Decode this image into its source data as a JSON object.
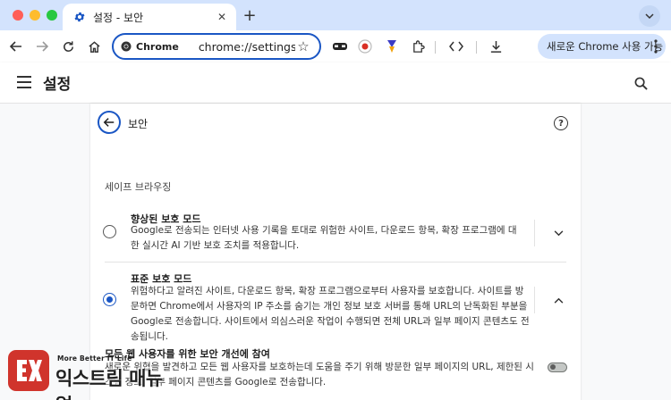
{
  "browser": {
    "tab": {
      "title": "설정 - 보안"
    },
    "omnibox": {
      "chip_label": "Chrome",
      "url": "chrome://settings/se..."
    },
    "update_label": "새로운 Chrome 사용 가능"
  },
  "settings": {
    "title": "설정",
    "page": {
      "heading": "보안",
      "help_label": "?"
    },
    "section_title": "세이프 브라우징",
    "options": [
      {
        "title": "향상된 보호 모드",
        "description": "Google로 전송되는 인터넷 사용 기록을 토대로 위험한 사이트, 다운로드 항목, 확장 프로그램에 대한 실시간 AI 기반 보호 조치를 적용합니다.",
        "selected": false
      },
      {
        "title": "표준 보호 모드",
        "description": "위험하다고 알려진 사이트, 다운로드 항목, 확장 프로그램으로부터 사용자를 보호합니다. 사이트를 방문하면 Chrome에서 사용자의 IP 주소를 숨기는 개인 정보 보호 서버를 통해 URL의 난독화된 부분을 Google로 전송합니다. 사이트에서 의심스러운 작업이 수행되면 전체 URL과 일부 페이지 콘텐츠도 전송됩니다.",
        "selected": true
      }
    ],
    "toggle_row": {
      "title": "모든 웹 사용자를 위한 보안 개선에 참여",
      "description": "새로운 위협을 발견하고 모든 웹 사용자를 보호하는데 도움을 주기 위해 방문한 일부 페이지의 URL, 제한된 시스템 정보, 일부 페이지 콘텐츠를 Google로 전송합니다.",
      "enabled": false
    }
  },
  "watermark": {
    "tagline": "More Better IT Life",
    "name": "익스트림 매뉴얼"
  },
  "colors": {
    "accent": "#1a56c4",
    "tabstrip": "#d3e3fd",
    "watermark_red": "#d0342c"
  }
}
